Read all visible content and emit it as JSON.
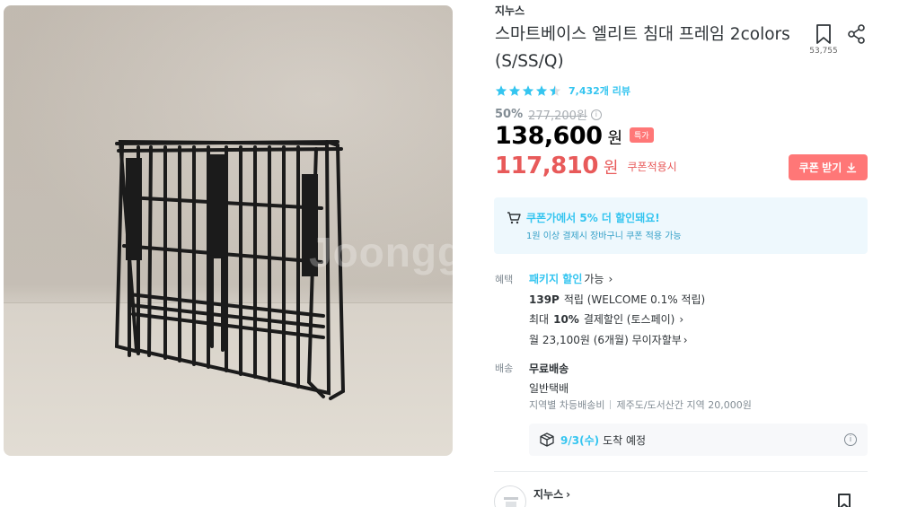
{
  "image": {
    "watermark": "Joongg"
  },
  "product": {
    "brand": "지누스",
    "title": "스마트베이스 엘리트 침대 프레임 2colors (S/SS/Q)",
    "bookmark_count": "53,755",
    "rating": {
      "stars": 4.5,
      "review_count": "7,432개 리뷰"
    },
    "discount_rate": "50%",
    "original_price": "277,200원",
    "price": "138,600",
    "price_unit": "원",
    "special_badge": "특가",
    "coupon_price": "117,810",
    "coupon_price_unit": "원",
    "coupon_applied_label": "쿠폰적용시",
    "coupon_button_label": "쿠폰 받기"
  },
  "coupon_notice": {
    "line1": "쿠폰가에서 5% 더 할인돼요!",
    "line2": "1원 이상 결제시 장바구니 쿠폰 적용 가능"
  },
  "benefits": {
    "label": "혜택",
    "package_blue": "패키지 할인",
    "package_rest": "가능",
    "points_bold": "139P",
    "points_rest": "적립 (WELCOME 0.1% 적립)",
    "pay_pre": "최대",
    "pay_bold": "10%",
    "pay_rest": "결제할인 (토스페이)",
    "installment": "월 23,100원 (6개월) 무이자할부"
  },
  "delivery": {
    "label": "배송",
    "free": "무료배송",
    "type": "일반택배",
    "region_a": "지역별 차등배송비",
    "region_b": "제주도/도서산간 지역 20,000원",
    "arrival_date": "9/3(수)",
    "arrival_text": "도착 예정"
  },
  "seller": {
    "name": "지누스"
  },
  "colors": {
    "accent_blue": "#35c5f0",
    "accent_red": "#f77",
    "price_red": "#e85a5a"
  },
  "icons": [
    "bookmark-icon",
    "share-icon",
    "star-icon",
    "download-icon",
    "cart-icon",
    "truck-box-icon",
    "info-icon",
    "chevron-right-icon"
  ]
}
